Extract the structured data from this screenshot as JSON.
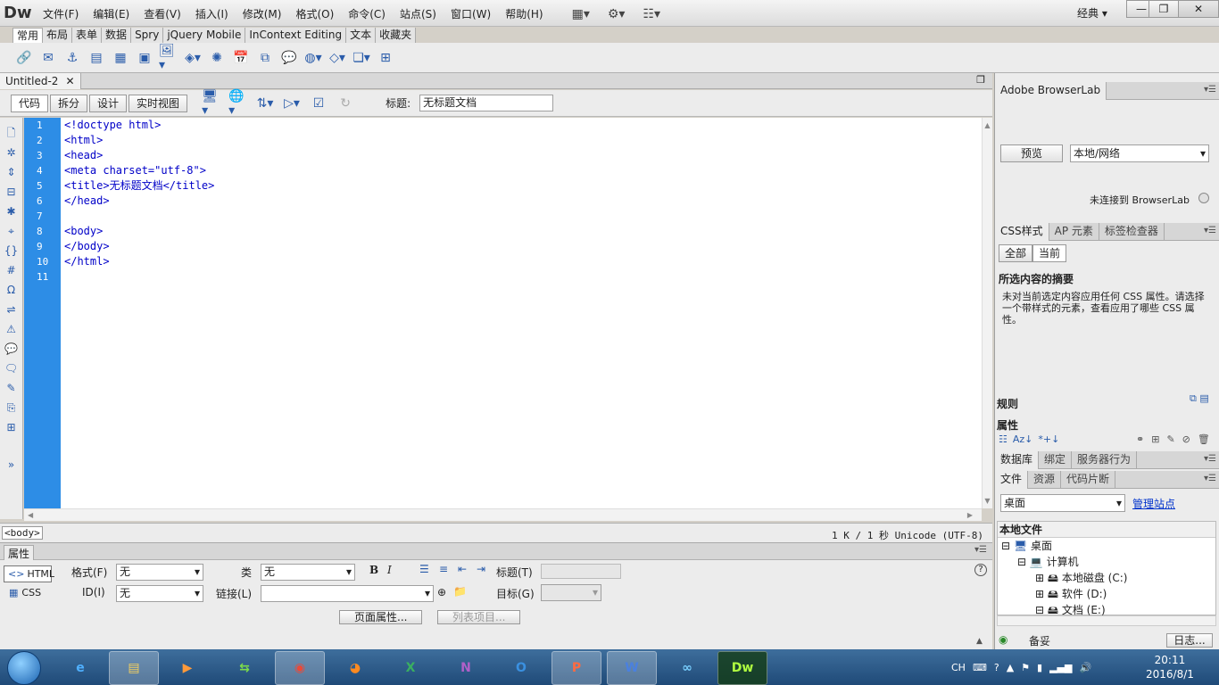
{
  "app": {
    "logo": "Dw"
  },
  "menu": [
    "文件(F)",
    "编辑(E)",
    "查看(V)",
    "插入(I)",
    "修改(M)",
    "格式(O)",
    "命令(C)",
    "站点(S)",
    "窗口(W)",
    "帮助(H)"
  ],
  "workspace": "经典",
  "insert_tabs": [
    "常用",
    "布局",
    "表单",
    "数据",
    "Spry",
    "jQuery Mobile",
    "InContext Editing",
    "文本",
    "收藏夹"
  ],
  "document": {
    "tab_name": "Untitled-2",
    "views": [
      "代码",
      "拆分",
      "设计",
      "实时视图"
    ],
    "title_label": "标题:",
    "title_value": "无标题文档",
    "lines": [
      "1",
      "2",
      "3",
      "4",
      "5",
      "6",
      "7",
      "8",
      "9",
      "10",
      "11"
    ],
    "code": [
      "<!doctype html>",
      "<html>",
      "<head>",
      "<meta charset=\"utf-8\">",
      "<title>无标题文档</title>",
      "</head>",
      "",
      "<body>",
      "</body>",
      "</html>",
      ""
    ]
  },
  "status": {
    "tag": "<body>",
    "info": "1 K / 1 秒 Unicode (UTF-8)"
  },
  "properties": {
    "title": "属性",
    "html_btn": "HTML",
    "css_btn": "CSS",
    "format_label": "格式(F)",
    "format_value": "无",
    "class_label": "类",
    "class_value": "无",
    "id_label": "ID(I)",
    "id_value": "无",
    "link_label": "链接(L)",
    "title_label": "标题(T)",
    "target_label": "目标(G)",
    "page_props_btn": "页面属性...",
    "list_item_btn": "列表项目..."
  },
  "browserlab": {
    "title": "Adobe BrowserLab",
    "preview_btn": "预览",
    "source_select": "本地/网络",
    "status": "未连接到 BrowserLab"
  },
  "css_panel": {
    "tabs": [
      "CSS样式",
      "AP 元素",
      "标签检查器"
    ],
    "modes": [
      "全部",
      "当前"
    ],
    "summary_title": "所选内容的摘要",
    "summary_text": "未对当前选定内容应用任何 CSS 属性。请选择一个带样式的元素，查看应用了哪些 CSS 属性。",
    "rules_label": "规则",
    "props_label": "属性"
  },
  "db_panel": {
    "tabs": [
      "数据库",
      "绑定",
      "服务器行为"
    ]
  },
  "files_panel": {
    "tabs": [
      "文件",
      "资源",
      "代码片断"
    ],
    "location": "桌面",
    "manage_link": "管理站点",
    "header": "本地文件",
    "tree": [
      "桌面",
      "计算机",
      "本地磁盘 (C:)",
      "软件 (D:)",
      "文档 (E:)"
    ],
    "footer_label": "备妥",
    "log_btn": "日志..."
  },
  "taskbar": {
    "apps": [
      "IE",
      "Files",
      "Media",
      "Sync",
      "Chrome",
      "Firefox",
      "Excel",
      "OneNote",
      "Outlook",
      "PowerPoint",
      "Word",
      "Baidu",
      "Dw"
    ],
    "lang": "CH",
    "time": "20:11",
    "date": "2016/8/1"
  }
}
